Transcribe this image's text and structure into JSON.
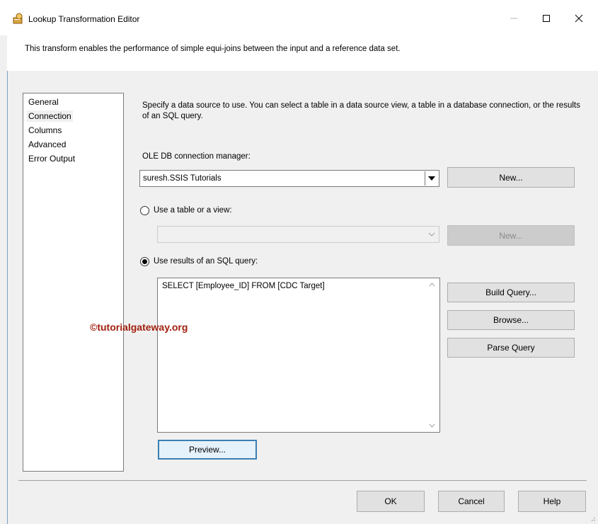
{
  "window": {
    "title": "Lookup Transformation Editor",
    "controls": {
      "minimize": "–",
      "maximize": "☐",
      "close": "✕"
    }
  },
  "header": {
    "description": "This transform enables the performance of simple equi-joins between the input and a reference data set."
  },
  "sidebar": {
    "items": [
      {
        "label": "General"
      },
      {
        "label": "Connection",
        "selected": true
      },
      {
        "label": "Columns"
      },
      {
        "label": "Advanced"
      },
      {
        "label": "Error Output"
      }
    ]
  },
  "connection": {
    "description": "Specify a data source to use. You can select a table in a data source view, a table in a database connection, or the results of an SQL query.",
    "manager_label": "OLE DB connection manager:",
    "manager_value": "suresh.SSIS Tutorials",
    "new_button": "New...",
    "table_option_label": "Use a table or a view:",
    "table_value": "",
    "table_new_button": "New...",
    "sql_option_label": "Use results of an SQL query:",
    "sql_selected": true,
    "sql_query": "SELECT [Employee_ID] FROM [CDC Target]",
    "build_query_button": "Build Query...",
    "browse_button": "Browse...",
    "parse_query_button": "Parse Query",
    "preview_button": "Preview..."
  },
  "watermark": "©tutorialgateway.org",
  "footer": {
    "ok": "OK",
    "cancel": "Cancel",
    "help": "Help"
  },
  "colors": {
    "accent": "#3c7fb1",
    "watermark": "#a0200f",
    "window_bg": "#f0f0f0",
    "button_bg": "#e1e1e1"
  }
}
